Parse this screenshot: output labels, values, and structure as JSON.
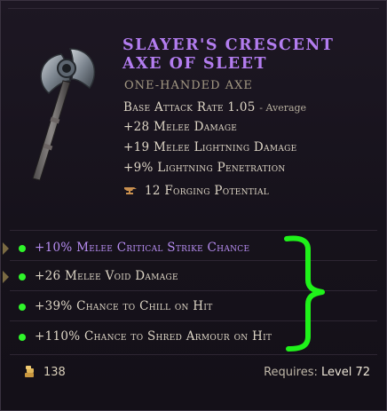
{
  "item": {
    "title": "Slayer's Crescent Axe of Sleet",
    "type": "One-Handed Axe",
    "attack_rate_label": "Base Attack Rate 1.05",
    "attack_rate_tag": "- Average",
    "implicits": [
      "+28 Melee Damage",
      "+19 Melee Lightning Damage",
      "+9% Lightning Penetration"
    ],
    "forging_potential": "12 Forging Potential"
  },
  "affixes": [
    {
      "text": "+10% Melee Critical Strike Chance",
      "color": "#b78df2"
    },
    {
      "text": "+26 Melee Void Damage",
      "color": "#ded6c6"
    },
    {
      "text": "+39% Chance to Chill on Hit",
      "color": "#ded6c6"
    },
    {
      "text": "+110% Chance to Shred Armour on Hit",
      "color": "#ded6c6"
    }
  ],
  "footer": {
    "gold": "138",
    "requires_label": "Requires:",
    "requires_level": "Level 72"
  },
  "colors": {
    "title": "#b37df0",
    "highlight_dot": "#2ff52a",
    "annotation": "#1ff21a"
  },
  "icons": {
    "weapon": "crescent-axe-icon",
    "forge": "anvil-icon",
    "gold": "gold-coins-icon"
  }
}
